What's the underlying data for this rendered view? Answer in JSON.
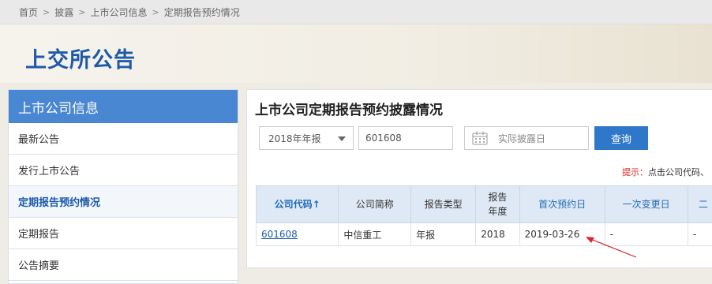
{
  "breadcrumb": {
    "items": [
      "首页",
      "披露",
      "上市公司信息",
      "定期报告预约情况"
    ],
    "separator": ">"
  },
  "banner": {
    "title": "上交所公告"
  },
  "sidebar": {
    "header": "上市公司信息",
    "items": [
      {
        "label": "最新公告"
      },
      {
        "label": "发行上市公告"
      },
      {
        "label": "定期报告预约情况",
        "active": true
      },
      {
        "label": "定期报告"
      },
      {
        "label": "公告摘要"
      }
    ]
  },
  "main": {
    "title": "上市公司定期报告预约披露情况",
    "filters": {
      "report_type": "2018年年报",
      "code_value": "601608",
      "date_label": "实际披露日",
      "query_button": "查询"
    },
    "hint_label": "提示：",
    "hint_text": "点击公司代码、",
    "table": {
      "headers": {
        "code": "公司代码",
        "sort_arrow": "↑",
        "name": "公司简称",
        "report_type": "报告类型",
        "year_line1": "报告",
        "year_line2": "年度",
        "first_date": "首次预约日",
        "first_change": "一次变更日",
        "next_col": "二"
      },
      "rows": [
        {
          "code": "601608",
          "name": "中信重工",
          "report_type": "年报",
          "year": "2018",
          "first_date": "2019-03-26",
          "first_change": "-",
          "next_col": "-"
        }
      ]
    }
  },
  "colors": {
    "brand_blue": "#1e5aa8",
    "sidebar_header": "#4a87d2",
    "button": "#2f78c9",
    "annotation_arrow": "#d9262b"
  },
  "icons": {
    "calendar": "calendar-icon",
    "dropdown": "chevron-down-icon",
    "sort": "sort-up-icon"
  }
}
